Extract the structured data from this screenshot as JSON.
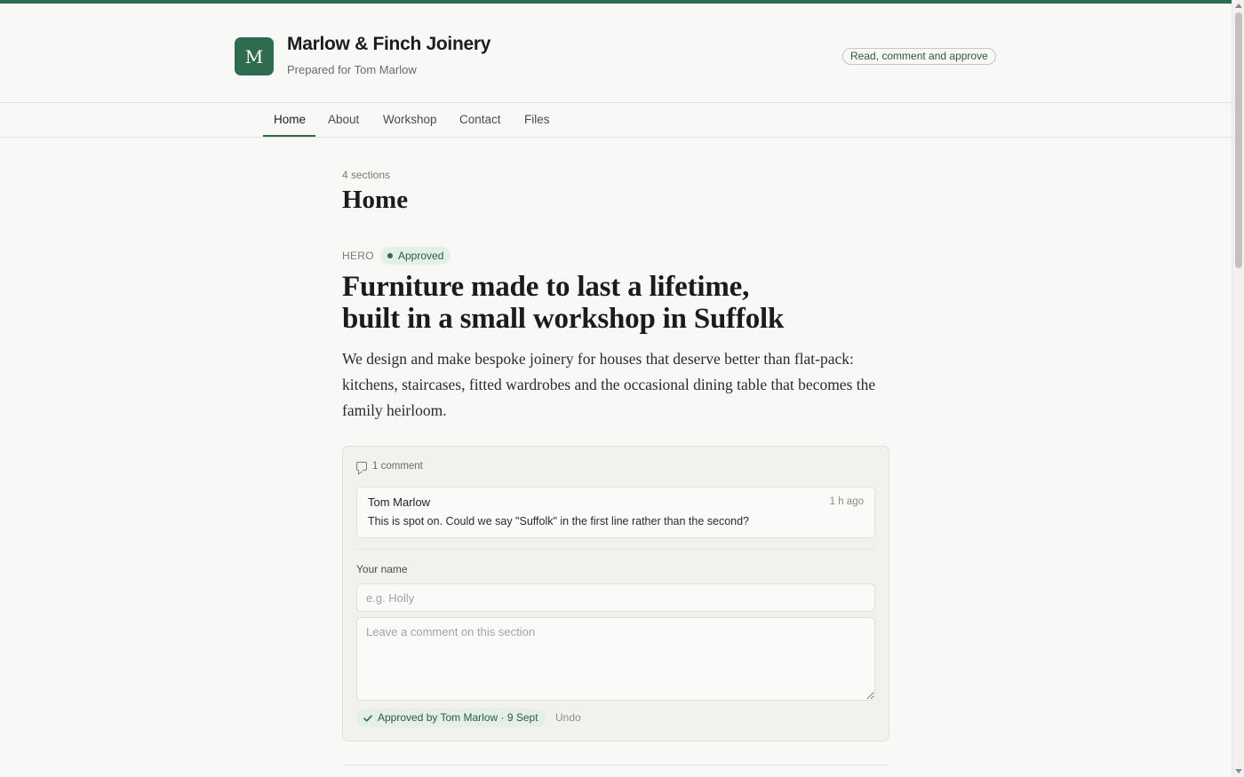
{
  "header": {
    "logo_letter": "M",
    "brand_name": "Marlow & Finch Joinery",
    "prepared_for": "Prepared for Tom Marlow",
    "mode_label": "Read, comment and approve"
  },
  "nav": {
    "items": [
      {
        "label": "Home",
        "active": true
      },
      {
        "label": "About",
        "active": false
      },
      {
        "label": "Workshop",
        "active": false
      },
      {
        "label": "Contact",
        "active": false
      },
      {
        "label": "Files",
        "active": false
      }
    ]
  },
  "page": {
    "section_count": "4 sections",
    "title": "Home"
  },
  "hero": {
    "label": "HERO",
    "status": "Approved",
    "headline_line1": "Furniture made to last a lifetime,",
    "headline_line2": "built in a small workshop in Suffolk",
    "body": "We design and make bespoke joinery for houses that deserve better than flat-pack: kitchens, staircases, fitted wardrobes and the occasional dining table that becomes the family heirloom."
  },
  "comments": {
    "count_label": "1 comment",
    "items": [
      {
        "author": "Tom Marlow",
        "time": "1 h ago",
        "text": "This is spot on. Could we say \"Suffolk\" in the first line rather than the second?"
      }
    ],
    "form": {
      "name_label": "Your name",
      "name_placeholder": "e.g. Holly",
      "comment_placeholder": "Leave a comment on this section"
    },
    "approval": {
      "text": "Approved by Tom Marlow · 9 Sept",
      "undo_label": "Undo"
    }
  },
  "colors": {
    "accent": "#2e6a4d",
    "approved_bg": "#e4efe7",
    "page_bg": "#f8f8f6"
  }
}
